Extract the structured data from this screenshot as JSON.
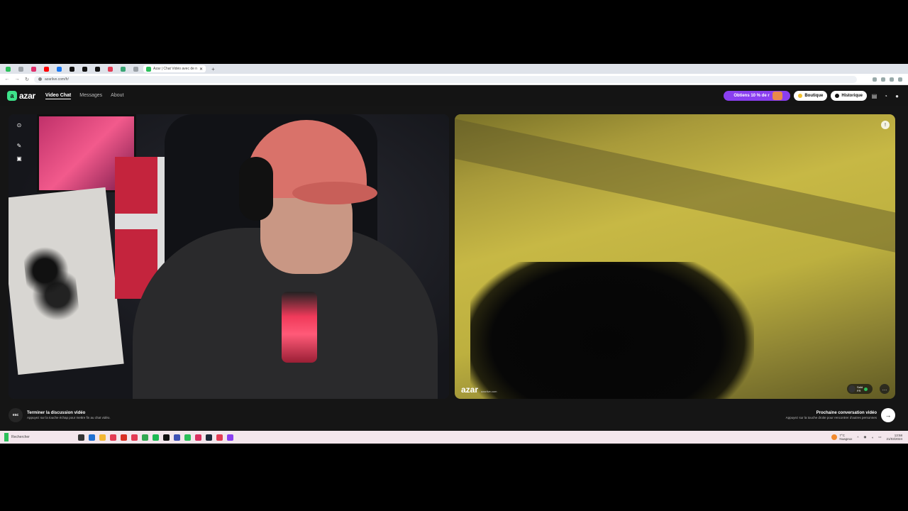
{
  "browser": {
    "active_tab_title": "Azar | Chat Vidéo avec de n",
    "new_tab_label": "+",
    "url": "azarlive.com/fr/",
    "tab_colors": [
      "#2bbf5a",
      "#9aa0a6",
      "#e1306c",
      "#ff0000",
      "#1877f2",
      "#111111",
      "#111111",
      "#111111",
      "#e33b54",
      "#3aa675",
      "#9aa0a6"
    ]
  },
  "app": {
    "logo_text": "azar",
    "nav": [
      {
        "label": "Video Chat",
        "active": true
      },
      {
        "label": "Messages",
        "active": false
      },
      {
        "label": "About",
        "active": false
      }
    ],
    "promo_label": "Obtiens 10 % de r",
    "shop_label": "Boutique",
    "history_label": "Historique",
    "accent_color": "#8a3ff0"
  },
  "remote_video": {
    "watermark": "azar",
    "watermark_sub": "azarlive.com",
    "peer_name": "Saïd",
    "peer_sub": "FR"
  },
  "footer": {
    "esc_key": "esc",
    "end_title": "Terminer la discussion vidéo",
    "end_sub": "Appuyez sur la touche échap pour mettre fin au chat vidéo.",
    "next_title": "Prochaine conversation vidéo",
    "next_sub": "Appuyez sur la touche droite pour rencontrer d'autres personnes"
  },
  "taskbar": {
    "search_text": "Rechercher",
    "weather_temp": "7°C",
    "weather_desc": "Nuageux",
    "time": "13:58",
    "date": "21/03/2024"
  }
}
